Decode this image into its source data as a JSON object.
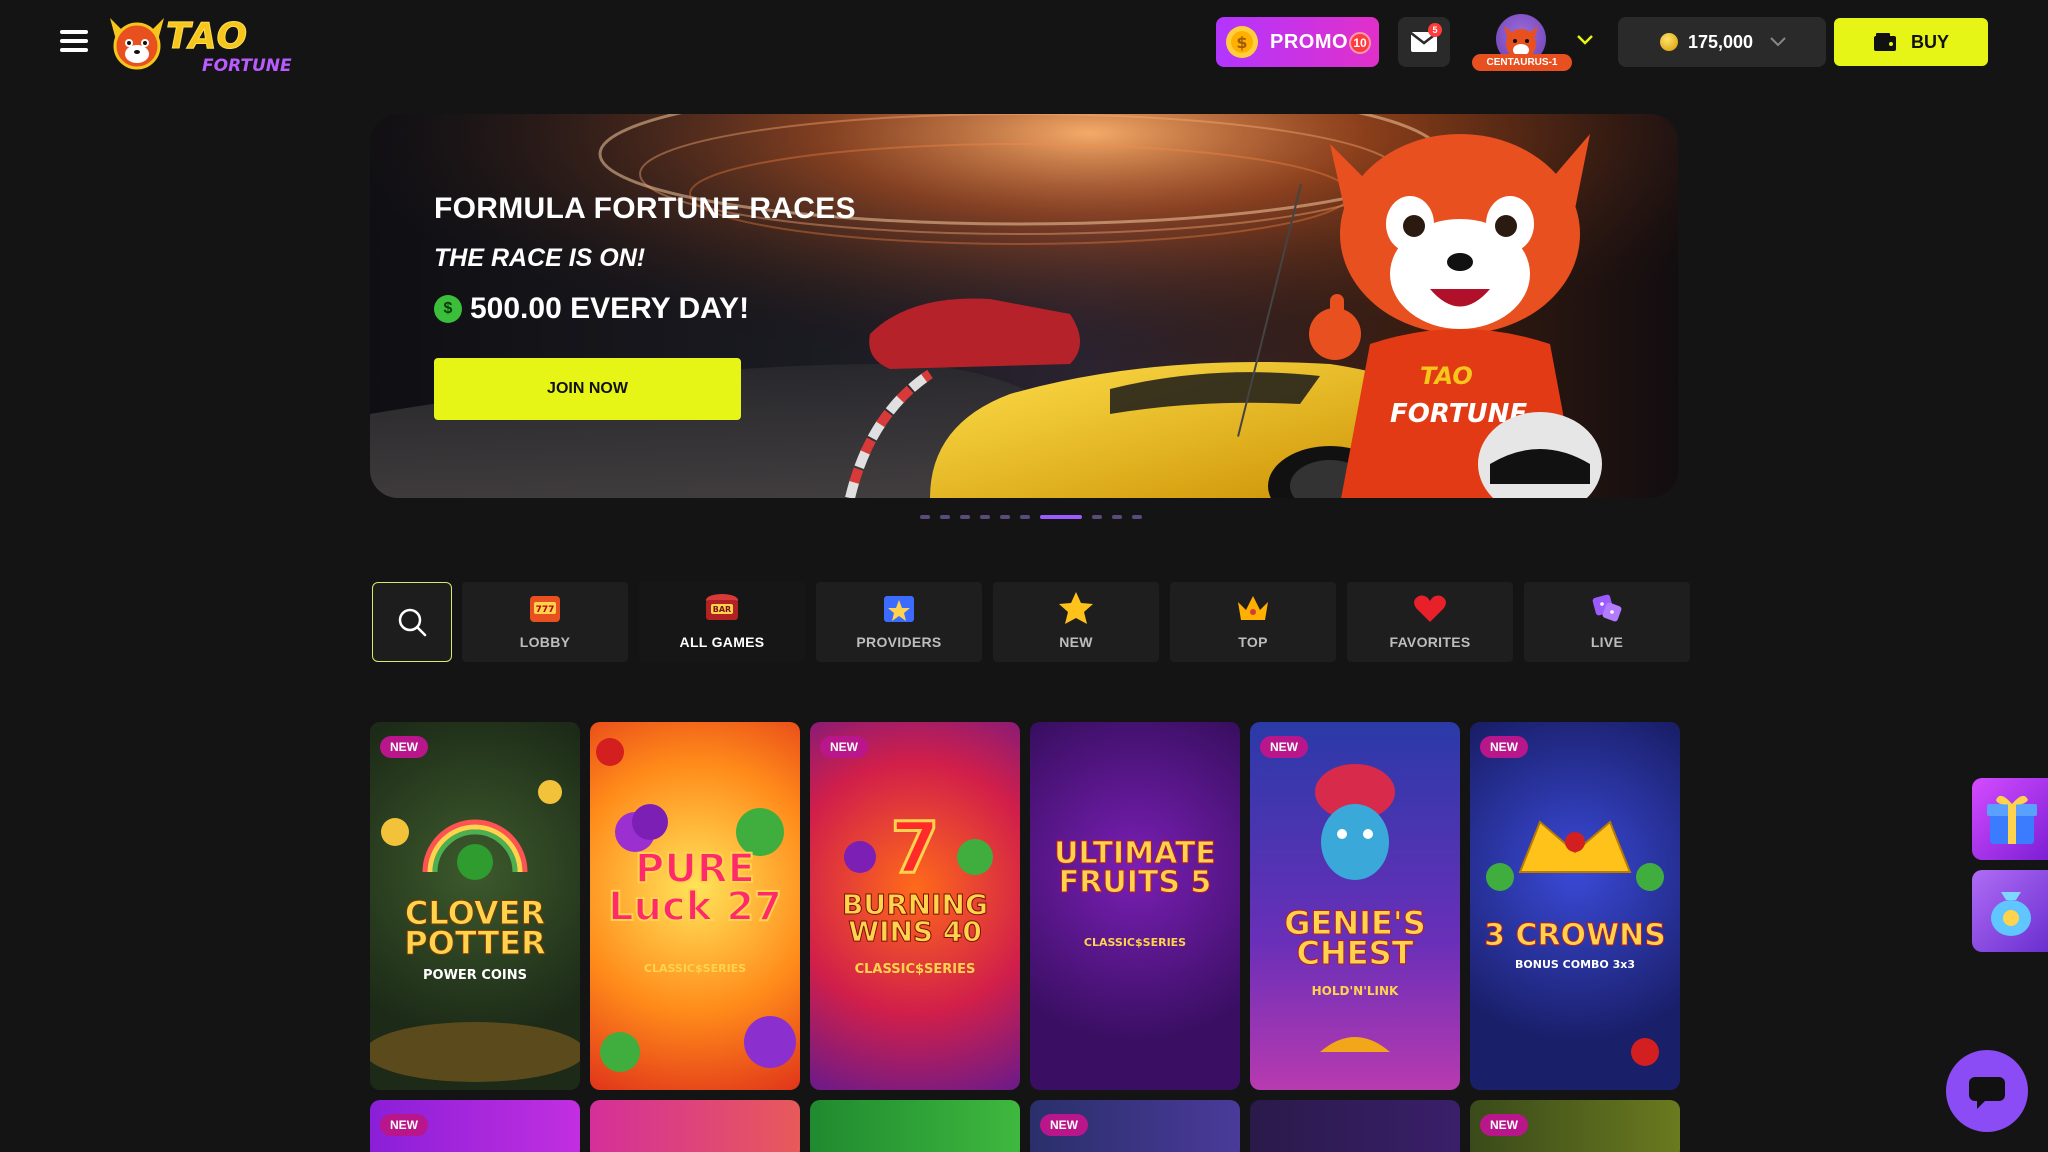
{
  "header": {
    "logo": {
      "line1": "TAO",
      "line2": "FORTUNE"
    },
    "promo": {
      "label": "PROMO",
      "count": "10"
    },
    "mail": {
      "badge": "5"
    },
    "user": {
      "name": "CENTAURUS-1"
    },
    "balance": {
      "value": "175,000"
    },
    "buy_label": "BUY"
  },
  "banner": {
    "title": "FORMULA FORTUNE RACES",
    "subtitle": "THE RACE IS ON!",
    "currency_symbol": "$",
    "amount": "500.00 EVERY DAY!",
    "cta_label": "JOIN NOW",
    "mascot_suit_line1": "TAO",
    "mascot_suit_line2": "FORTUNE",
    "slides_total": 10,
    "active_slide": 6
  },
  "tabs": [
    {
      "label": "LOBBY",
      "icon": "slot-machine-icon"
    },
    {
      "label": "ALL GAMES",
      "icon": "bar-slot-icon",
      "active": true
    },
    {
      "label": "PROVIDERS",
      "icon": "star-box-icon"
    },
    {
      "label": "NEW",
      "icon": "star-icon"
    },
    {
      "label": "TOP",
      "icon": "crown-icon"
    },
    {
      "label": "FAVORITES",
      "icon": "heart-icon"
    },
    {
      "label": "LIVE",
      "icon": "dice-icon"
    }
  ],
  "games": [
    {
      "badge": "NEW",
      "title": "CLOVER POTTER",
      "subtitle": "POWER COINS"
    },
    {
      "badge": "",
      "title": "PURE Luck 27",
      "subtitle": "CLASSIC$SERIES"
    },
    {
      "badge": "NEW",
      "title": "BURNING WINS 40",
      "subtitle": "CLASSIC$SERIES"
    },
    {
      "badge": "",
      "title": "ULTIMATE FRUITS 5",
      "subtitle": "CLASSIC$SERIES"
    },
    {
      "badge": "NEW",
      "title": "GENIE'S CHEST",
      "subtitle": "HOLD'N'LINK"
    },
    {
      "badge": "NEW",
      "title": "3 CROWNS",
      "subtitle": "BONUS COMBO 3x3"
    }
  ],
  "games_row2_badges": [
    "NEW",
    "",
    "",
    "NEW",
    "",
    "NEW"
  ],
  "colors": {
    "accent_yellow": "#e6f516",
    "promo_purple": "#b235ff",
    "active_dot": "#9b5cff",
    "new_badge": "#b8168a"
  }
}
